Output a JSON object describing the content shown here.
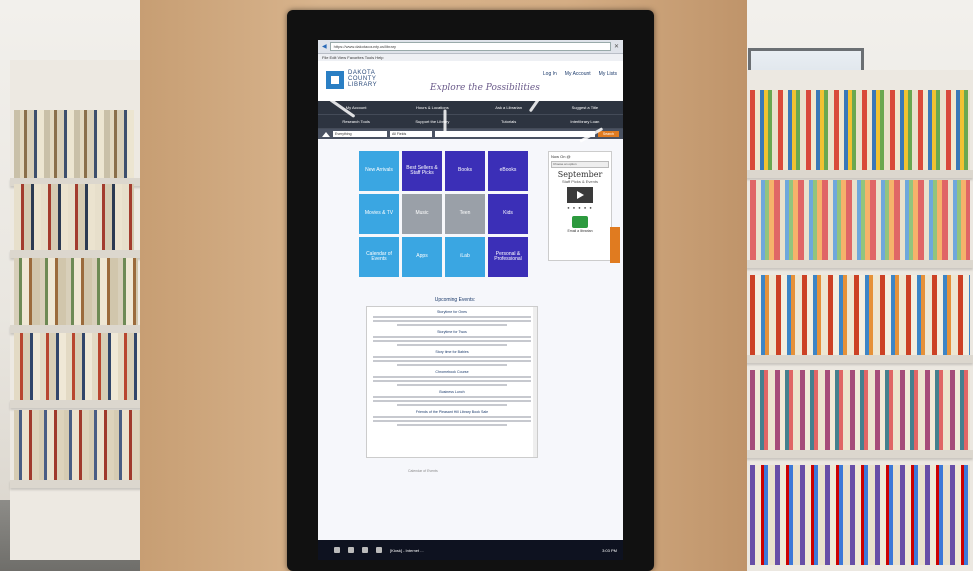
{
  "browser": {
    "url": "https://www.dakotacounty.us/library",
    "menu": "File  Edit  View  Favorites  Tools  Help"
  },
  "header": {
    "logo_lines": "DAKOTA\nCOUNTY\nLIBRARY",
    "tagline": "Explore the Possibilities",
    "links": [
      "Log In",
      "My Account",
      "My Lists"
    ]
  },
  "nav": [
    "My Account",
    "Hours & Locations",
    "Ask a Librarian",
    "Suggest a Title",
    "Research Tools",
    "Support the Library",
    "Tutorials",
    "Interlibrary Loan"
  ],
  "search": {
    "scope": "Everything",
    "field": "All Fields",
    "button": "Search"
  },
  "tiles": [
    {
      "label": "New Arrivals",
      "color": "#3aa6e2"
    },
    {
      "label": "Best Sellers & Staff Picks",
      "color": "#3b2fb7"
    },
    {
      "label": "Books",
      "color": "#3b2fb7"
    },
    {
      "label": "eBooks",
      "color": "#3b2fb7"
    },
    {
      "label": "Movies & TV",
      "color": "#3aa6e2"
    },
    {
      "label": "Music",
      "color": "#9aa0a8"
    },
    {
      "label": "Teen",
      "color": "#9aa0a8"
    },
    {
      "label": "Kids",
      "color": "#3b2fb7"
    },
    {
      "label": "Calendar of Events",
      "color": "#3aa6e2"
    },
    {
      "label": "Apps",
      "color": "#3aa6e2"
    },
    {
      "label": "iLab",
      "color": "#3aa6e2"
    },
    {
      "label": "Personal & Professional",
      "color": "#3b2fb7"
    }
  ],
  "side": {
    "head": "Now On @",
    "select": "Choose an option",
    "month": "September",
    "sub": "Staff Picks & Events",
    "dots": "● ● ● ● ●",
    "mail_label": "Email a librarian"
  },
  "events": {
    "title": "Upcoming Events:",
    "items": [
      "Storytime for Ones",
      "Storytime for Twos",
      "Story time for Babies",
      "Chromebook Course",
      "Business Lunch",
      "Friends of the Pleasant Hill Library Book Sale"
    ]
  },
  "footer": "Calendar of Events",
  "taskbar": {
    "task": "[Kiosk] - Internet ...",
    "clock": "3:03 PM"
  }
}
